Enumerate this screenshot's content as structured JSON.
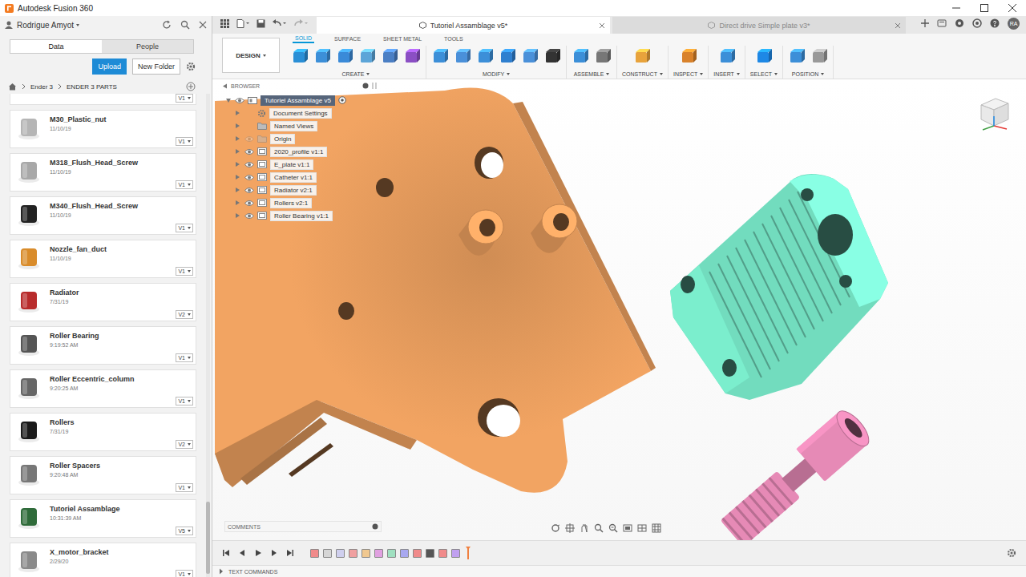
{
  "window": {
    "title": "Autodesk Fusion 360"
  },
  "data_panel": {
    "user": "Rodrigue Amyot",
    "tabs": [
      {
        "label": "Data",
        "selected": true
      },
      {
        "label": "People",
        "selected": false
      }
    ],
    "buttons": {
      "upload": "Upload",
      "new_folder": "New Folder"
    },
    "breadcrumb": [
      "Ender 3",
      "ENDER 3 PARTS"
    ],
    "partial_item": {
      "version": "V1"
    },
    "items": [
      {
        "name": "M30_Plastic_nut",
        "date": "11/10/19",
        "version": "V1",
        "color": "#b5b5b5"
      },
      {
        "name": "M318_Flush_Head_Screw",
        "date": "11/10/19",
        "version": "V1",
        "color": "#a8a8a8"
      },
      {
        "name": "M340_Flush_Head_Screw",
        "date": "11/10/19",
        "version": "V1",
        "color": "#222222"
      },
      {
        "name": "Nozzle_fan_duct",
        "date": "11/10/19",
        "version": "V1",
        "color": "#d98c2b"
      },
      {
        "name": "Radiator",
        "date": "7/31/19",
        "version": "V2",
        "color": "#b82b2b"
      },
      {
        "name": "Roller Bearing",
        "date": "9:19:52 AM",
        "version": "V1",
        "color": "#555555"
      },
      {
        "name": "Roller Eccentric_column",
        "date": "9:20:25 AM",
        "version": "V1",
        "color": "#666666"
      },
      {
        "name": "Rollers",
        "date": "7/31/19",
        "version": "V2",
        "color": "#1a1a1a"
      },
      {
        "name": "Roller Spacers",
        "date": "9:20:48 AM",
        "version": "V1",
        "color": "#777777"
      },
      {
        "name": "Tutoriel Assamblage",
        "date": "10:31:39 AM",
        "version": "V5",
        "color": "#2f6b3a"
      },
      {
        "name": "X_motor_bracket",
        "date": "2/29/20",
        "version": "V1",
        "color": "#8a8a8a"
      }
    ]
  },
  "doc_tabs": [
    {
      "label": "Tutoriel Assamblage v5*",
      "selected": true
    },
    {
      "label": "Direct drive Simple plate v3*",
      "selected": false
    }
  ],
  "user_badge": "RA",
  "toolbar": {
    "workspace": "DESIGN",
    "tabs": [
      {
        "label": "SOLID",
        "selected": true
      },
      {
        "label": "SURFACE",
        "selected": false
      },
      {
        "label": "SHEET METAL",
        "selected": false
      },
      {
        "label": "TOOLS",
        "selected": false
      }
    ],
    "groups": [
      {
        "label": "CREATE",
        "icons": [
          "#2a8fd6",
          "#3c8fd8",
          "#3a8ad8",
          "#5ca5d8",
          "#4b7fc4",
          "#8b4fc4"
        ]
      },
      {
        "label": "MODIFY",
        "icons": [
          "#3c8fd8",
          "#4a90d9",
          "#3c8fd8",
          "#2f7fcf",
          "#4a90d9",
          "#333333"
        ]
      },
      {
        "label": "ASSEMBLE",
        "icons": [
          "#3c8fd8",
          "#777777"
        ]
      },
      {
        "label": "CONSTRUCT",
        "icons": [
          "#e8a33c"
        ]
      },
      {
        "label": "INSPECT",
        "icons": [
          "#d9822b"
        ]
      },
      {
        "label": "INSERT",
        "icons": [
          "#3c8fd8"
        ]
      },
      {
        "label": "SELECT",
        "icons": [
          "#1e88e5"
        ]
      },
      {
        "label": "POSITION",
        "icons": [
          "#3c8fd8",
          "#999999"
        ]
      }
    ]
  },
  "browser": {
    "title": "BROWSER",
    "nodes": [
      {
        "label": "Tutoriel Assamblage v5",
        "kind": "root",
        "selected": true,
        "expanded": true,
        "visible": true
      },
      {
        "label": "Document Settings",
        "kind": "settings",
        "selected": false,
        "expanded": false
      },
      {
        "label": "Named Views",
        "kind": "views",
        "selected": false,
        "expanded": false
      },
      {
        "label": "Origin",
        "kind": "origin",
        "selected": false,
        "expanded": false,
        "visible": false
      },
      {
        "label": "2020_profile v1:1",
        "kind": "component",
        "selected": false,
        "expanded": false,
        "visible": true
      },
      {
        "label": "E_plate v1:1",
        "kind": "component",
        "selected": false,
        "expanded": false,
        "visible": true
      },
      {
        "label": "Catheter v1:1",
        "kind": "component",
        "selected": false,
        "expanded": false,
        "visible": true
      },
      {
        "label": "Radiator v2:1",
        "kind": "component",
        "selected": false,
        "expanded": false,
        "visible": true
      },
      {
        "label": "Rollers v2:1",
        "kind": "component",
        "selected": false,
        "expanded": false,
        "visible": true
      },
      {
        "label": "Roller Bearing v1:1",
        "kind": "component",
        "selected": false,
        "expanded": false,
        "visible": true
      }
    ]
  },
  "scene": {
    "bodies": [
      {
        "kind": "plate",
        "color": "#f2a462"
      },
      {
        "kind": "radiator",
        "color": "#72dcbe"
      },
      {
        "kind": "throat",
        "color": "#e68ab6"
      }
    ]
  },
  "comments": "COMMENTS",
  "timeline": {
    "features": [
      "#f08a8a",
      "#d6d6d6",
      "#cfcfee",
      "#f0a0a0",
      "#f0c890",
      "#e0a0e0",
      "#9fe0c0",
      "#a8a8f0",
      "#f08a8a",
      "#555555",
      "#f08a8a",
      "#c0a0f0"
    ]
  },
  "text_commands": "TEXT COMMANDS"
}
